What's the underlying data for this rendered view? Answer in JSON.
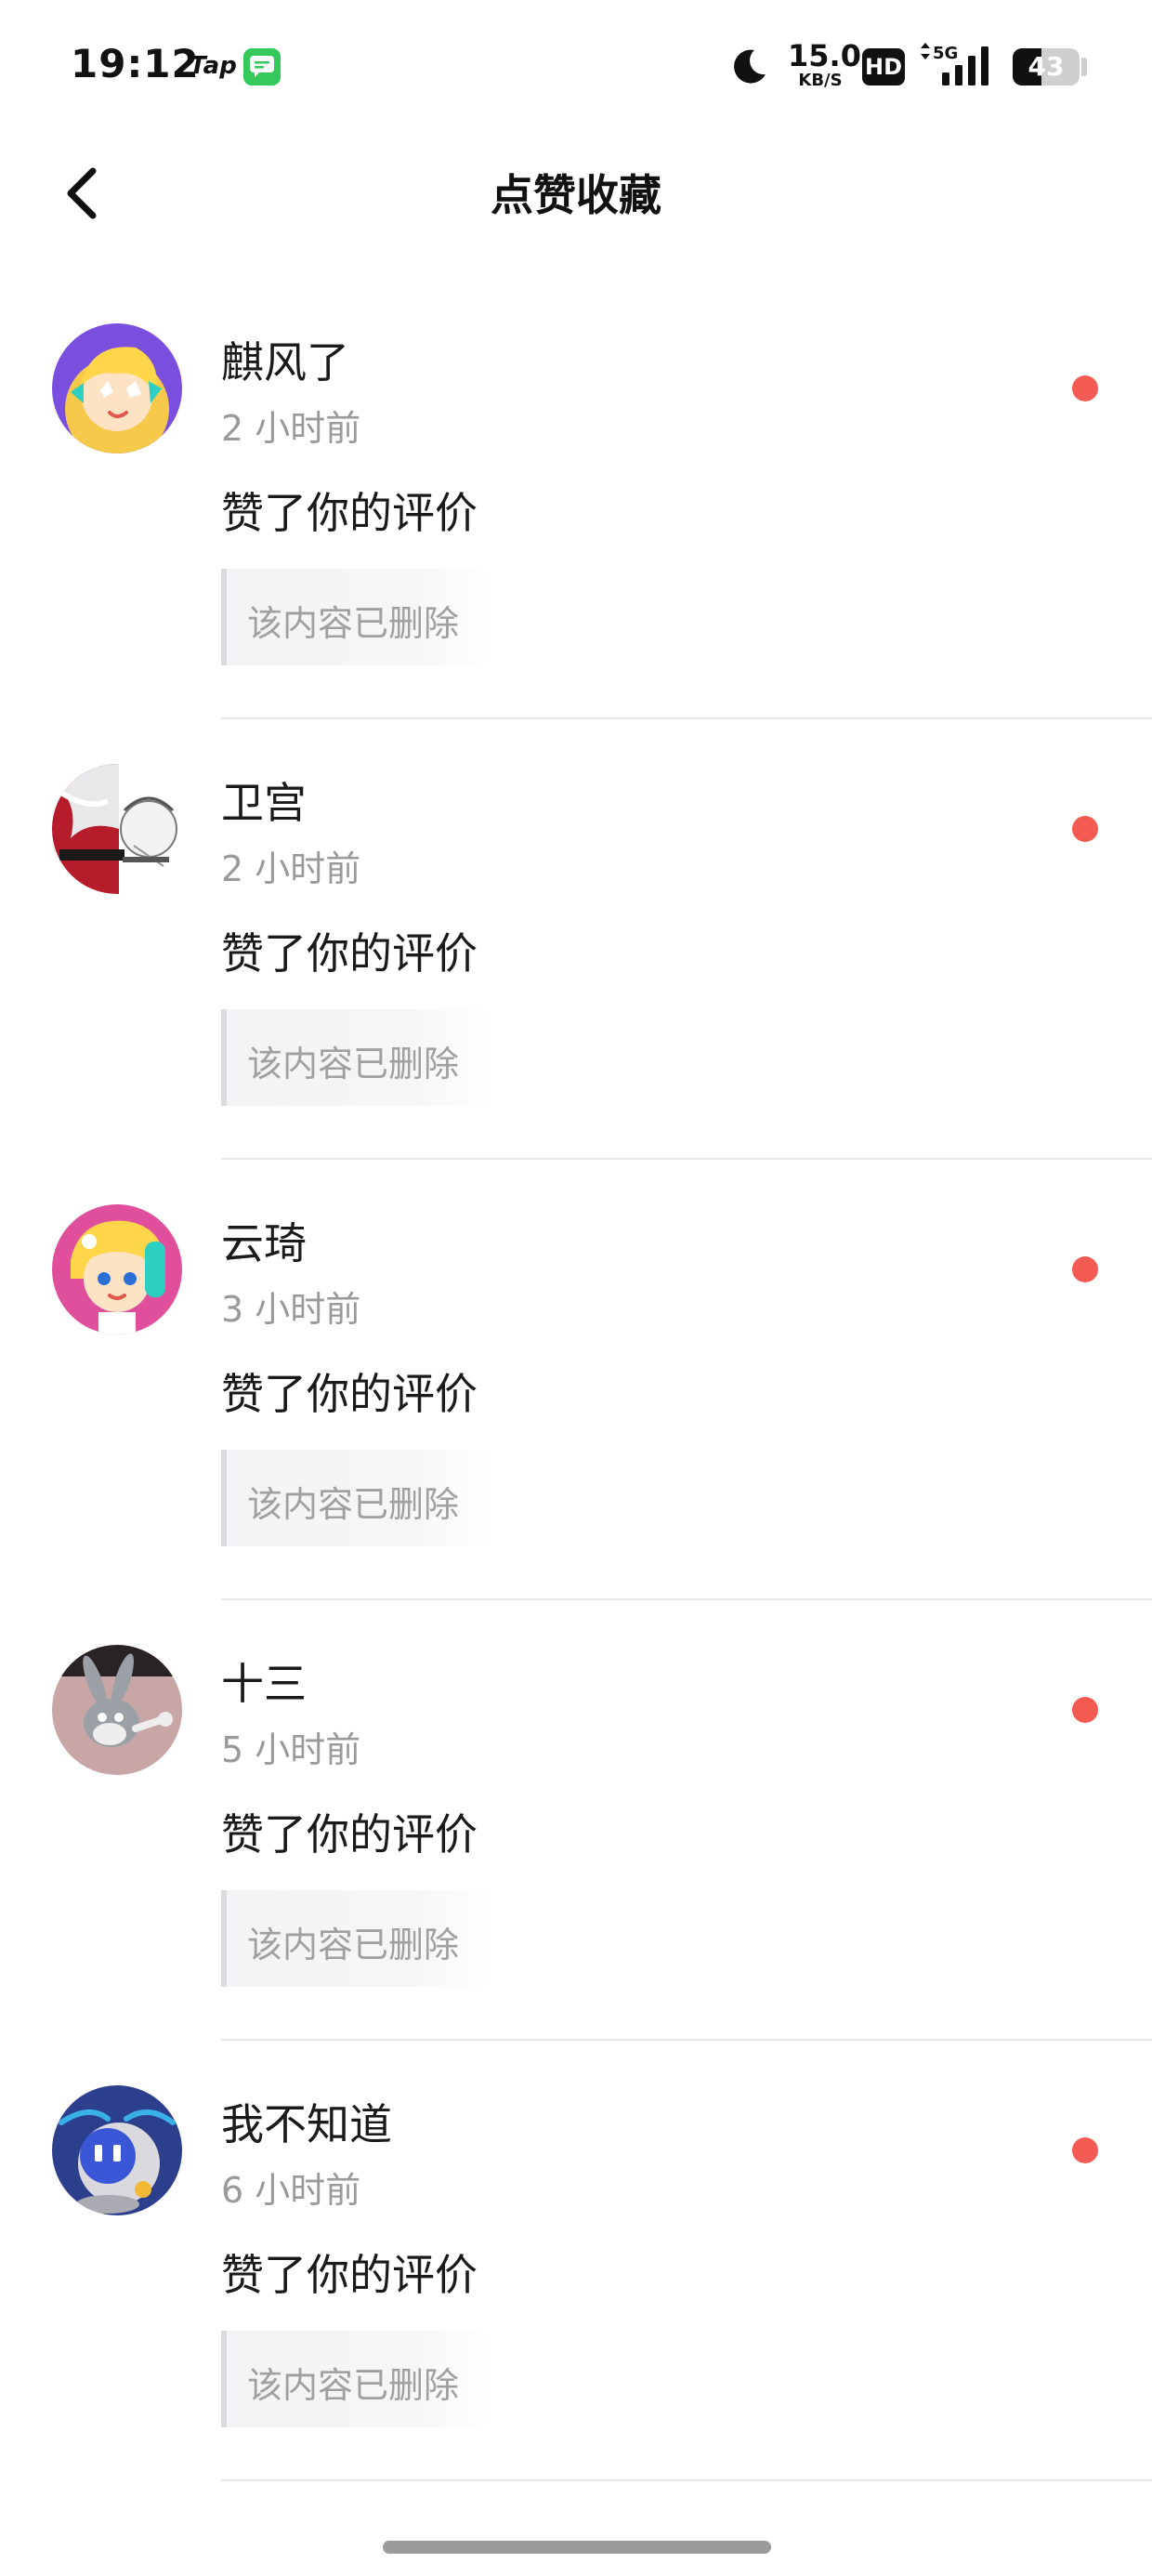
{
  "status_bar": {
    "time": "19:12",
    "app_label": "Tap",
    "net_speed_value": "15.0",
    "net_speed_unit": "KB/S",
    "hd_label": "HD",
    "network_label": "5G",
    "battery_level": "43",
    "battery_fraction": 0.43,
    "icons": [
      "tap-icon",
      "chat-icon",
      "moon-icon",
      "hd-icon",
      "signal-icon",
      "battery-icon"
    ]
  },
  "header": {
    "title": "点赞收藏",
    "back_icon": "chevron-left-icon"
  },
  "notifications": [
    {
      "username": "麒风了",
      "time": "2 小时前",
      "action": "赞了你的评价",
      "quote": "该内容已删除",
      "unread": true
    },
    {
      "username": "卫宫",
      "time": "2 小时前",
      "action": "赞了你的评价",
      "quote": "该内容已删除",
      "unread": true
    },
    {
      "username": "云琦",
      "time": "3 小时前",
      "action": "赞了你的评价",
      "quote": "该内容已删除",
      "unread": true
    },
    {
      "username": "十三",
      "time": "5 小时前",
      "action": "赞了你的评价",
      "quote": "该内容已删除",
      "unread": true
    },
    {
      "username": "我不知道",
      "time": "6 小时前",
      "action": "赞了你的评价",
      "quote": "该内容已删除",
      "unread": true
    }
  ],
  "colors": {
    "unread_dot": "#f25a52",
    "secondary_text": "#9a9a9a",
    "divider": "#e7e7e7"
  }
}
